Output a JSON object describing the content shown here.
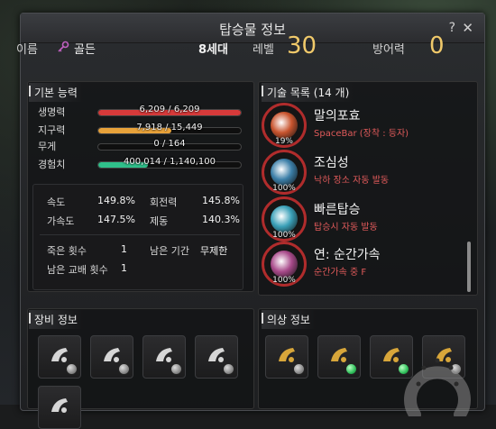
{
  "window": {
    "title": "탑승물 정보",
    "help_label": "?",
    "close_label": "✕"
  },
  "header": {
    "name_label": "이름",
    "name_value": "골든",
    "generation": "8세대",
    "level_label": "레벨",
    "level_value": "30",
    "defense_label": "방어력",
    "defense_value": "0"
  },
  "basic": {
    "title": "기본 능력",
    "stats": [
      {
        "label": "생명력",
        "text": "6,209 / 6,209",
        "fill": 1.0,
        "color": "#d63a3a"
      },
      {
        "label": "지구력",
        "text": "7,918 / 15,449",
        "fill": 0.5125,
        "color": "#e8a23a"
      },
      {
        "label": "무게",
        "text": "0 / 164",
        "fill": 0.0,
        "color": "#9a9a9a"
      },
      {
        "label": "경험치",
        "text": "400,014 / 1,140,100",
        "fill": 0.3509,
        "color": "#2fbf8a"
      }
    ],
    "speed_label": "속도",
    "speed_value": "149.8%",
    "turn_label": "회전력",
    "turn_value": "145.8%",
    "accel_label": "가속도",
    "accel_value": "147.5%",
    "brake_label": "제동",
    "brake_value": "140.3%",
    "deaths_label": "죽은 횟수",
    "deaths_value": "1",
    "period_label": "남은 기간",
    "period_value": "무제한",
    "trades_label": "남은 교배 횟수",
    "trades_value": "1"
  },
  "skills": {
    "title": "기술 목록 (14 개)",
    "items": [
      {
        "name": "말의포효",
        "desc": "SpaceBar (장착 : 등자)",
        "pct": "19%",
        "icon": "horse-roar-icon",
        "color": "#c8542e"
      },
      {
        "name": "조심성",
        "desc": "낙하 장소 자동 발동",
        "pct": "100%",
        "icon": "caution-icon",
        "color": "#3c7fa8"
      },
      {
        "name": "빠른탑승",
        "desc": "탑승시 자동 발동",
        "pct": "100%",
        "icon": "quick-mount-icon",
        "color": "#3aa0b8"
      },
      {
        "name": "연: 순간가속",
        "desc": "순간가속 중 F",
        "pct": "100%",
        "icon": "instant-accel-icon",
        "color": "#a84a8a"
      }
    ]
  },
  "equipment": {
    "title": "장비 정보",
    "slots": [
      {
        "icon": "barding-icon",
        "dot": "gray"
      },
      {
        "icon": "saddle-icon",
        "dot": "gray"
      },
      {
        "icon": "stirrup-icon",
        "dot": "gray"
      },
      {
        "icon": "horseshoe-icon",
        "dot": "gray"
      },
      {
        "icon": "training-icon",
        "dot": "none"
      }
    ]
  },
  "costume": {
    "title": "의상 정보",
    "slots": [
      {
        "icon": "barding-costume-icon",
        "dot": "gray"
      },
      {
        "icon": "saddle-costume-icon",
        "dot": "green"
      },
      {
        "icon": "stirrup-costume-icon",
        "dot": "green"
      },
      {
        "icon": "horseshoe-costume-icon",
        "dot": "gray"
      }
    ]
  }
}
